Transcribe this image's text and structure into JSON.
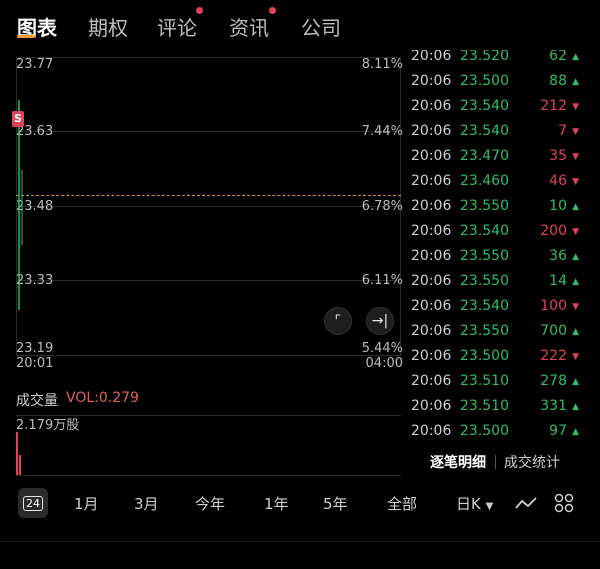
{
  "tabs": [
    {
      "label": "图表",
      "active": true
    },
    {
      "label": "期权",
      "active": false
    },
    {
      "label": "评论",
      "active": false,
      "dot": true
    },
    {
      "label": "资讯",
      "active": false,
      "dot": true
    },
    {
      "label": "公司",
      "active": false
    }
  ],
  "chart": {
    "left_labels": [
      "23.77",
      "23.63",
      "23.48",
      "23.33",
      "23.19"
    ],
    "right_labels": [
      "8.11%",
      "7.44%",
      "6.78%",
      "6.11%",
      "5.44%"
    ],
    "time_start": "20:01",
    "time_end": "04:00",
    "marker": "S",
    "volume_label": "成交量",
    "volume_value": "VOL:0.279",
    "volume_axis": "2.179万股"
  },
  "trades": [
    {
      "time": "20:06",
      "price": "23.500",
      "vol": "88",
      "dir": "up"
    },
    {
      "time": "20:06",
      "price": "23.540",
      "vol": "212",
      "dir": "down"
    },
    {
      "time": "20:06",
      "price": "23.540",
      "vol": "7",
      "dir": "down"
    },
    {
      "time": "20:06",
      "price": "23.470",
      "vol": "35",
      "dir": "down"
    },
    {
      "time": "20:06",
      "price": "23.460",
      "vol": "46",
      "dir": "down"
    },
    {
      "time": "20:06",
      "price": "23.550",
      "vol": "10",
      "dir": "up"
    },
    {
      "time": "20:06",
      "price": "23.540",
      "vol": "200",
      "dir": "down"
    },
    {
      "time": "20:06",
      "price": "23.550",
      "vol": "36",
      "dir": "up"
    },
    {
      "time": "20:06",
      "price": "23.550",
      "vol": "14",
      "dir": "up"
    },
    {
      "time": "20:06",
      "price": "23.540",
      "vol": "100",
      "dir": "down"
    },
    {
      "time": "20:06",
      "price": "23.550",
      "vol": "700",
      "dir": "up"
    },
    {
      "time": "20:06",
      "price": "23.500",
      "vol": "222",
      "dir": "down"
    },
    {
      "time": "20:06",
      "price": "23.510",
      "vol": "278",
      "dir": "up"
    },
    {
      "time": "20:06",
      "price": "23.510",
      "vol": "331",
      "dir": "up"
    },
    {
      "time": "20:06",
      "price": "23.500",
      "vol": "97",
      "dir": "up"
    }
  ],
  "trade_tabs": {
    "detail": "逐笔明细",
    "stats": "成交统计"
  },
  "periods": [
    "24",
    "1月",
    "3月",
    "今年",
    "1年",
    "5年",
    "全部"
  ],
  "kline_select": "日K",
  "colors": {
    "up": "#2ebd6b",
    "down": "#e0435a",
    "accent": "#ff9a2e"
  }
}
